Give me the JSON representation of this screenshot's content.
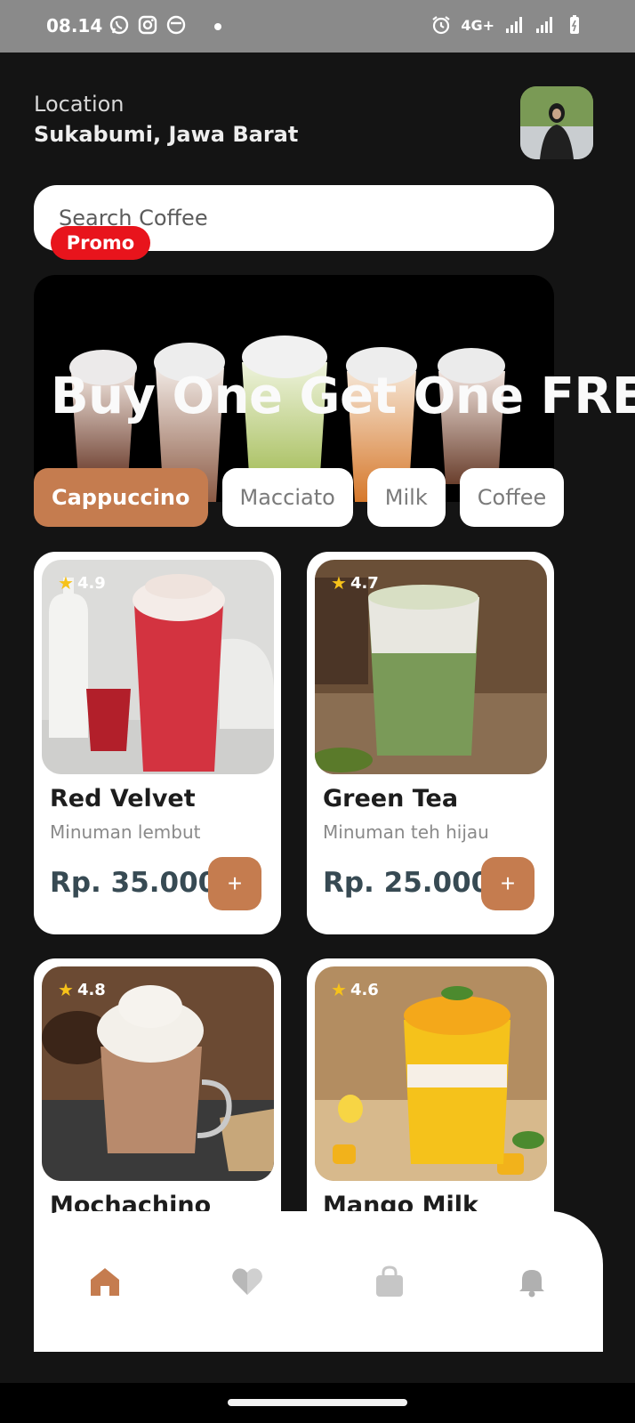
{
  "status_bar": {
    "time": "08.14",
    "network": "4G+"
  },
  "header": {
    "location_label": "Location",
    "location_value": "Sukabumi, Jawa Barat"
  },
  "search": {
    "placeholder": "Search Coffee"
  },
  "promo": {
    "badge": "Promo",
    "title": "Buy One Get One FREE"
  },
  "categories": [
    {
      "label": "Cappuccino",
      "active": true
    },
    {
      "label": "Macciato",
      "active": false
    },
    {
      "label": "Milk",
      "active": false
    },
    {
      "label": "Coffee",
      "active": false
    }
  ],
  "products": [
    {
      "name": "Red Velvet",
      "desc": "Minuman lembut",
      "price": "Rp. 35.000",
      "rating": "4.9"
    },
    {
      "name": "Green Tea",
      "desc": "Minuman teh hijau",
      "price": "Rp. 25.000",
      "rating": "4.7"
    },
    {
      "name": "Mochachino",
      "desc": "",
      "price": "",
      "rating": "4.8"
    },
    {
      "name": "Mango Milk",
      "desc": "",
      "price": "",
      "rating": "4.6"
    }
  ],
  "add_label": "+",
  "nav": {
    "items": [
      "home-icon",
      "heart-icon",
      "bag-icon",
      "bell-icon"
    ],
    "active_color": "#c57c4f",
    "inactive_color": "#b8b8b8"
  },
  "colors": {
    "accent": "#c57c4f",
    "promo_red": "#e8141c",
    "price": "#374a53"
  }
}
